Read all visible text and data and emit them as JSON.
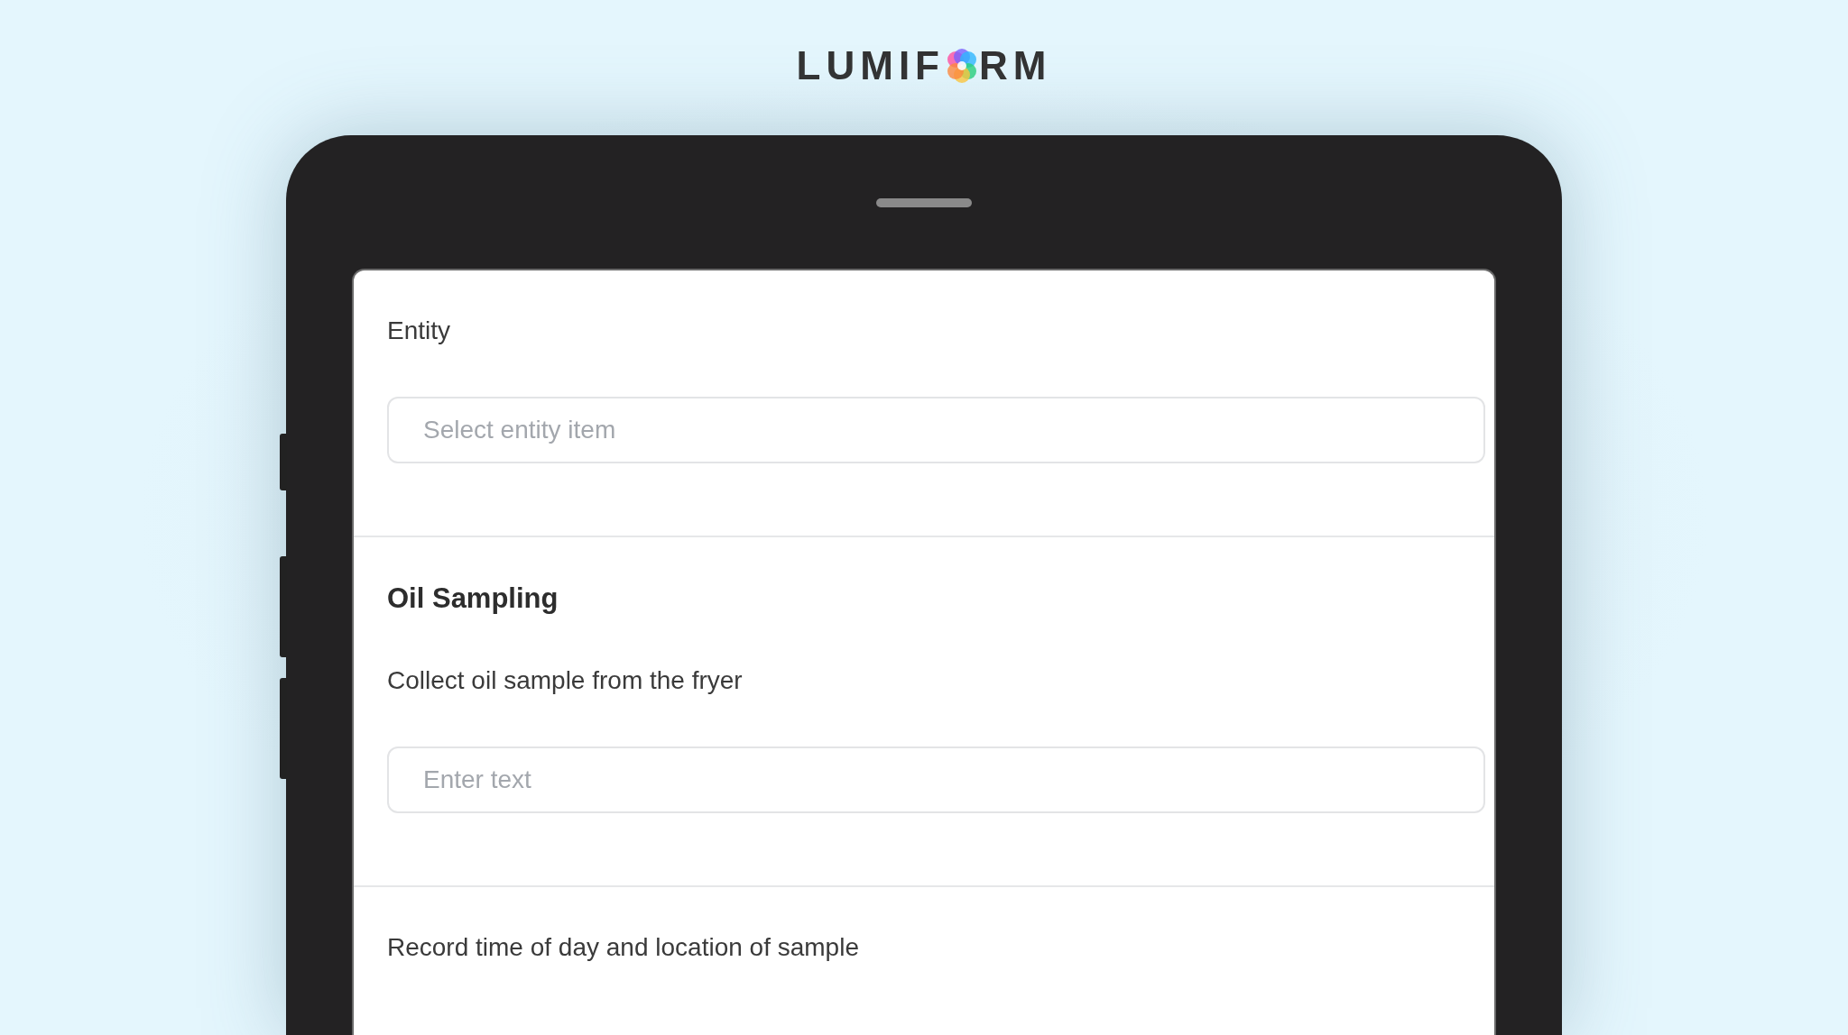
{
  "logo": {
    "text_before": "LUMIF",
    "text_after": "RM"
  },
  "sections": [
    {
      "items": [
        {
          "kind": "label",
          "text": "Entity"
        },
        {
          "kind": "input",
          "placeholder": "Select entity item"
        }
      ]
    },
    {
      "items": [
        {
          "kind": "heading",
          "text": "Oil Sampling"
        },
        {
          "kind": "label",
          "text": "Collect oil sample from the fryer"
        },
        {
          "kind": "input",
          "placeholder": "Enter text"
        }
      ]
    },
    {
      "items": [
        {
          "kind": "label",
          "text": "Record time of day and location of sample"
        }
      ]
    }
  ]
}
